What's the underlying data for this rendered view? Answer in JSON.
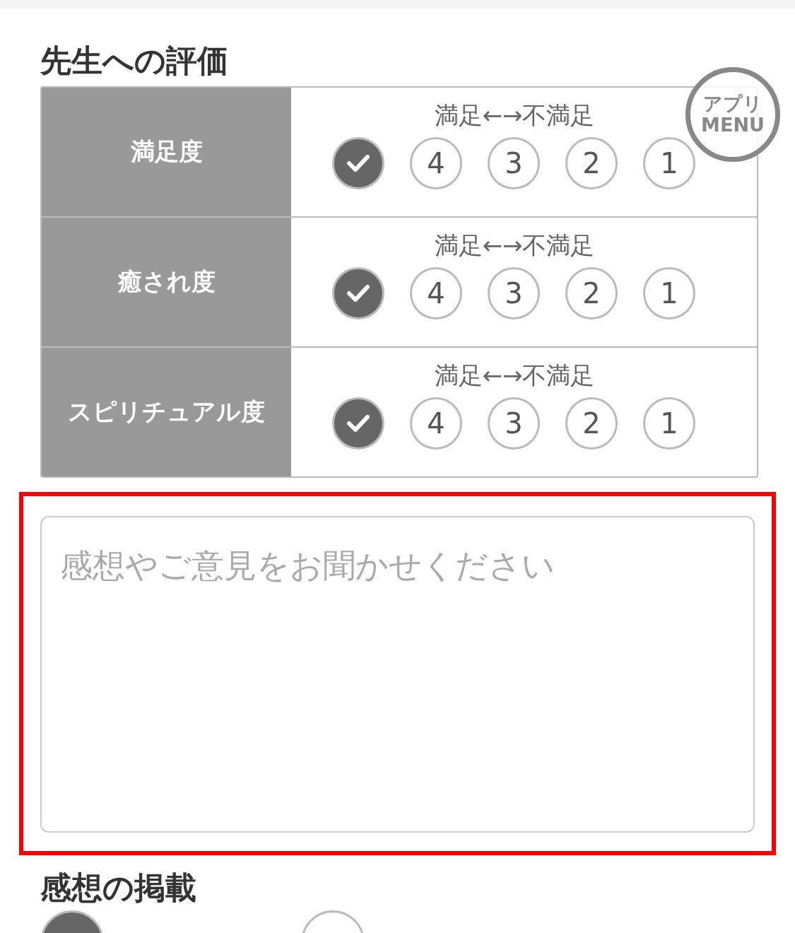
{
  "rating_section": {
    "title": "先生への評価",
    "rows": [
      {
        "label": "満足度",
        "scale_caption": "満足←→不満足",
        "options": [
          {
            "selected": true
          },
          {
            "label": "4",
            "selected": false
          },
          {
            "label": "3",
            "selected": false
          },
          {
            "label": "2",
            "selected": false
          },
          {
            "label": "1",
            "selected": false
          }
        ]
      },
      {
        "label": "癒され度",
        "scale_caption": "満足←→不満足",
        "options": [
          {
            "selected": true
          },
          {
            "label": "4",
            "selected": false
          },
          {
            "label": "3",
            "selected": false
          },
          {
            "label": "2",
            "selected": false
          },
          {
            "label": "1",
            "selected": false
          }
        ]
      },
      {
        "label": "スピリチュアル度",
        "scale_caption": "満足←→不満足",
        "options": [
          {
            "selected": true
          },
          {
            "label": "4",
            "selected": false
          },
          {
            "label": "3",
            "selected": false
          },
          {
            "label": "2",
            "selected": false
          },
          {
            "label": "1",
            "selected": false
          }
        ]
      }
    ]
  },
  "comment": {
    "placeholder": "感想やご意見をお聞かせください",
    "highlighted": true
  },
  "publish_section": {
    "title": "感想の掲載",
    "options": [
      {
        "selected": true
      },
      {
        "selected": false
      }
    ]
  },
  "app_menu": {
    "lines": [
      "アプリ",
      "MENU"
    ]
  }
}
